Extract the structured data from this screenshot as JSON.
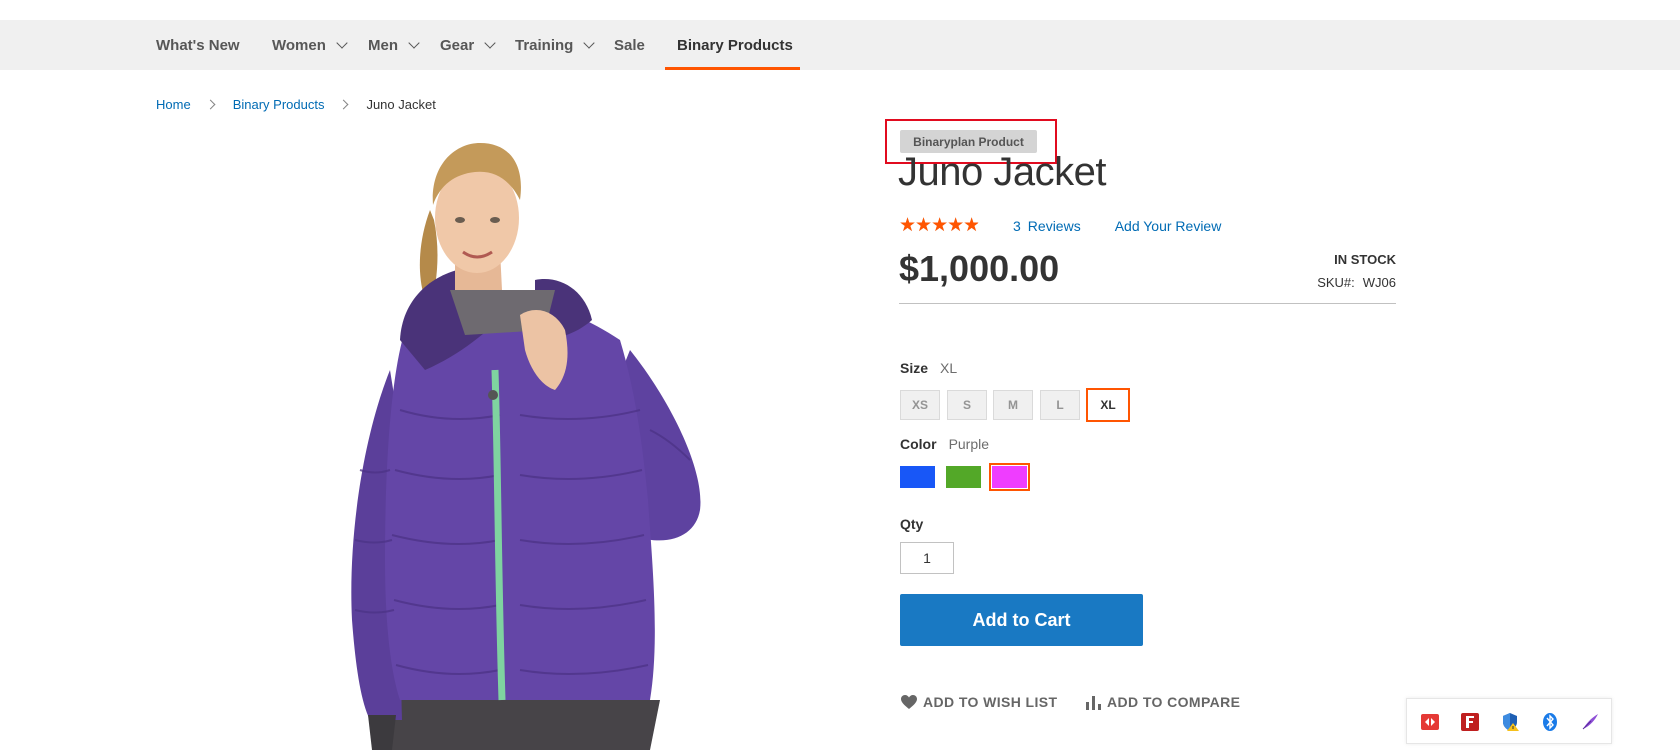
{
  "nav": {
    "items": [
      {
        "label": "What's New",
        "has_dropdown": false
      },
      {
        "label": "Women",
        "has_dropdown": true
      },
      {
        "label": "Men",
        "has_dropdown": true
      },
      {
        "label": "Gear",
        "has_dropdown": true
      },
      {
        "label": "Training",
        "has_dropdown": true
      },
      {
        "label": "Sale",
        "has_dropdown": false
      },
      {
        "label": "Binary Products",
        "has_dropdown": false,
        "active": true
      }
    ],
    "active_color": "#ff5501"
  },
  "breadcrumb": {
    "home": "Home",
    "category": "Binary Products",
    "current": "Juno Jacket"
  },
  "product": {
    "badge": "Binaryplan Product",
    "title": "Juno Jacket",
    "rating": {
      "value": 4.3,
      "max": 5
    },
    "reviews_count": "3",
    "reviews_label": "Reviews",
    "add_review": "Add Your Review",
    "price": "$1,000.00",
    "stock": "IN STOCK",
    "sku_label": "SKU#:",
    "sku": "WJ06",
    "size": {
      "label": "Size",
      "selected": "XL",
      "options": [
        "XS",
        "S",
        "M",
        "L",
        "XL"
      ]
    },
    "color": {
      "label": "Color",
      "selected": "Purple",
      "options": [
        {
          "name": "Blue",
          "hex": "#1857f7"
        },
        {
          "name": "Green",
          "hex": "#53a828"
        },
        {
          "name": "Purple",
          "hex": "#ef3dff"
        }
      ]
    },
    "qty": {
      "label": "Qty",
      "value": "1"
    },
    "add_to_cart": "Add to Cart",
    "wishlist": "ADD TO WISH LIST",
    "compare": "ADD TO COMPARE"
  },
  "colors": {
    "link": "#006bb4",
    "primary_button": "#1979c3",
    "accent": "#ff5501",
    "highlight_box": "#e10b1f"
  },
  "tray_icons": [
    "remote-desktop-icon",
    "filezilla-icon",
    "security-shield-warning-icon",
    "bluetooth-icon",
    "feather-pen-icon"
  ]
}
